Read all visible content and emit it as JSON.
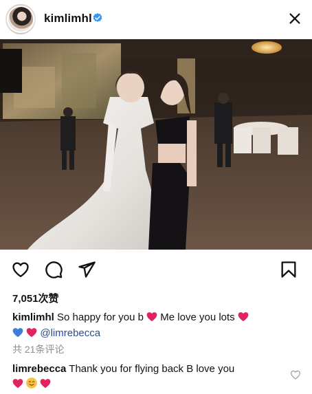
{
  "header": {
    "username": "kimlimhl",
    "verified_color": "#3897f0"
  },
  "photo": {
    "alt": "Two women posing at an event"
  },
  "actions": {
    "like_icon": "heart-outline-icon",
    "comment_icon": "comment-icon",
    "share_icon": "send-icon",
    "save_icon": "bookmark-icon"
  },
  "likes": {
    "text": "7,051次赞"
  },
  "caption": {
    "username": "kimlimhl",
    "text_1": "So happy for you b",
    "text_2": "Me love you lots",
    "mention": "@limrebecca"
  },
  "comments": {
    "count_text": "共 21条评论",
    "items": [
      {
        "username": "limrebecca",
        "text": "Thank you for flying back B love you"
      }
    ]
  },
  "colors": {
    "heart_red": "#e0245e",
    "heart_blue": "#3f7fd8",
    "mention": "#2d4c86",
    "muted": "#8e8e8e"
  }
}
